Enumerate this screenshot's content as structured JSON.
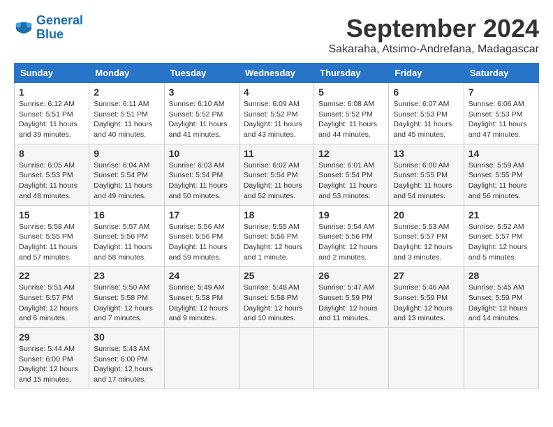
{
  "header": {
    "logo_line1": "General",
    "logo_line2": "Blue",
    "month_title": "September 2024",
    "subtitle": "Sakaraha, Atsimo-Andrefana, Madagascar"
  },
  "days_of_week": [
    "Sunday",
    "Monday",
    "Tuesday",
    "Wednesday",
    "Thursday",
    "Friday",
    "Saturday"
  ],
  "weeks": [
    [
      {
        "day": "1",
        "sunrise": "6:12 AM",
        "sunset": "5:51 PM",
        "daylight": "11 hours and 39 minutes."
      },
      {
        "day": "2",
        "sunrise": "6:11 AM",
        "sunset": "5:51 PM",
        "daylight": "11 hours and 40 minutes."
      },
      {
        "day": "3",
        "sunrise": "6:10 AM",
        "sunset": "5:52 PM",
        "daylight": "11 hours and 41 minutes."
      },
      {
        "day": "4",
        "sunrise": "6:09 AM",
        "sunset": "5:52 PM",
        "daylight": "11 hours and 43 minutes."
      },
      {
        "day": "5",
        "sunrise": "6:08 AM",
        "sunset": "5:52 PM",
        "daylight": "11 hours and 44 minutes."
      },
      {
        "day": "6",
        "sunrise": "6:07 AM",
        "sunset": "5:53 PM",
        "daylight": "11 hours and 45 minutes."
      },
      {
        "day": "7",
        "sunrise": "6:06 AM",
        "sunset": "5:53 PM",
        "daylight": "11 hours and 47 minutes."
      }
    ],
    [
      {
        "day": "8",
        "sunrise": "6:05 AM",
        "sunset": "5:53 PM",
        "daylight": "11 hours and 48 minutes."
      },
      {
        "day": "9",
        "sunrise": "6:04 AM",
        "sunset": "5:54 PM",
        "daylight": "11 hours and 49 minutes."
      },
      {
        "day": "10",
        "sunrise": "6:03 AM",
        "sunset": "5:54 PM",
        "daylight": "11 hours and 50 minutes."
      },
      {
        "day": "11",
        "sunrise": "6:02 AM",
        "sunset": "5:54 PM",
        "daylight": "11 hours and 52 minutes."
      },
      {
        "day": "12",
        "sunrise": "6:01 AM",
        "sunset": "5:54 PM",
        "daylight": "11 hours and 53 minutes."
      },
      {
        "day": "13",
        "sunrise": "6:00 AM",
        "sunset": "5:55 PM",
        "daylight": "11 hours and 54 minutes."
      },
      {
        "day": "14",
        "sunrise": "5:59 AM",
        "sunset": "5:55 PM",
        "daylight": "11 hours and 56 minutes."
      }
    ],
    [
      {
        "day": "15",
        "sunrise": "5:58 AM",
        "sunset": "5:55 PM",
        "daylight": "11 hours and 57 minutes."
      },
      {
        "day": "16",
        "sunrise": "5:57 AM",
        "sunset": "5:56 PM",
        "daylight": "11 hours and 58 minutes."
      },
      {
        "day": "17",
        "sunrise": "5:56 AM",
        "sunset": "5:56 PM",
        "daylight": "11 hours and 59 minutes."
      },
      {
        "day": "18",
        "sunrise": "5:55 AM",
        "sunset": "5:56 PM",
        "daylight": "12 hours and 1 minute."
      },
      {
        "day": "19",
        "sunrise": "5:54 AM",
        "sunset": "5:56 PM",
        "daylight": "12 hours and 2 minutes."
      },
      {
        "day": "20",
        "sunrise": "5:53 AM",
        "sunset": "5:57 PM",
        "daylight": "12 hours and 3 minutes."
      },
      {
        "day": "21",
        "sunrise": "5:52 AM",
        "sunset": "5:57 PM",
        "daylight": "12 hours and 5 minutes."
      }
    ],
    [
      {
        "day": "22",
        "sunrise": "5:51 AM",
        "sunset": "5:57 PM",
        "daylight": "12 hours and 6 minutes."
      },
      {
        "day": "23",
        "sunrise": "5:50 AM",
        "sunset": "5:58 PM",
        "daylight": "12 hours and 7 minutes."
      },
      {
        "day": "24",
        "sunrise": "5:49 AM",
        "sunset": "5:58 PM",
        "daylight": "12 hours and 9 minutes."
      },
      {
        "day": "25",
        "sunrise": "5:48 AM",
        "sunset": "5:58 PM",
        "daylight": "12 hours and 10 minutes."
      },
      {
        "day": "26",
        "sunrise": "5:47 AM",
        "sunset": "5:59 PM",
        "daylight": "12 hours and 11 minutes."
      },
      {
        "day": "27",
        "sunrise": "5:46 AM",
        "sunset": "5:59 PM",
        "daylight": "12 hours and 13 minutes."
      },
      {
        "day": "28",
        "sunrise": "5:45 AM",
        "sunset": "5:59 PM",
        "daylight": "12 hours and 14 minutes."
      }
    ],
    [
      {
        "day": "29",
        "sunrise": "5:44 AM",
        "sunset": "6:00 PM",
        "daylight": "12 hours and 15 minutes."
      },
      {
        "day": "30",
        "sunrise": "5:43 AM",
        "sunset": "6:00 PM",
        "daylight": "12 hours and 17 minutes."
      },
      null,
      null,
      null,
      null,
      null
    ]
  ]
}
